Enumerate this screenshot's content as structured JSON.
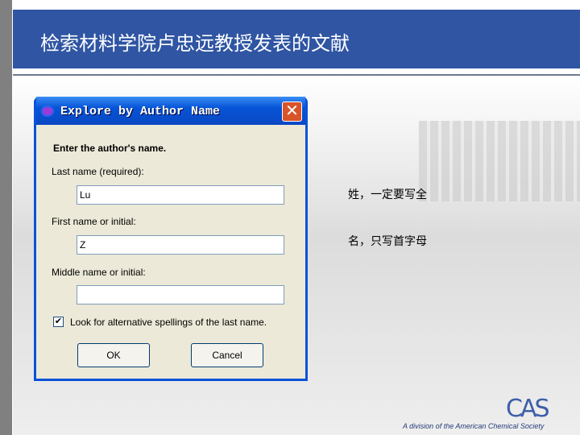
{
  "slide": {
    "title": "检索材料学院卢忠远教授发表的文献",
    "notes": [
      "姓，一定要写全",
      "名，只写首字母"
    ],
    "logo": "CAS",
    "tagline": "A division of the American Chemical Society"
  },
  "dialog": {
    "title": "Explore by Author Name",
    "prompt": "Enter the author's name.",
    "last_label": "Last name (required):",
    "last_value": "Lu",
    "first_label": "First name or initial:",
    "first_value": "Z",
    "middle_label": "Middle name or initial:",
    "middle_value": "",
    "alt_label": "Look for alternative spellings of the last name.",
    "alt_checked": true,
    "ok": "OK",
    "cancel": "Cancel",
    "close_glyph": "✕",
    "check_glyph": "✔"
  }
}
